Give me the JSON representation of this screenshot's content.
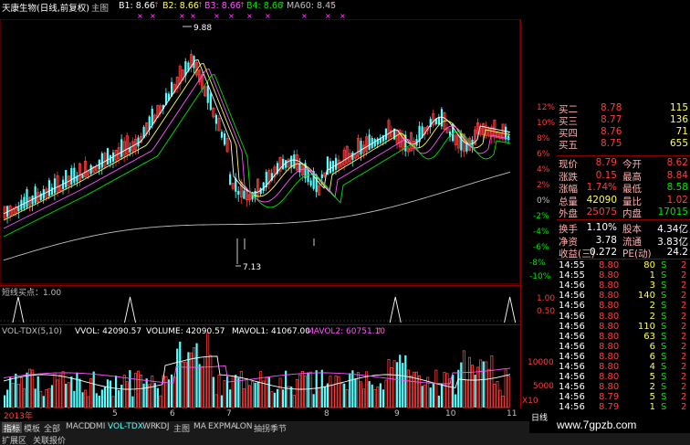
{
  "header": {
    "stock_name": "天康生物(日线,前复权)",
    "tab": "主图",
    "b1": "B1: 8.66",
    "b2": "B2: 8.66",
    "b3": "B3: 8.66",
    "b4": "B4: 8.66",
    "ma60": "MA60: 8.45"
  },
  "colors": {
    "up": "#ff3c3c",
    "down": "#54ffff",
    "border": "#8b0000",
    "ma_white": "#ffffff",
    "ma_yellow": "#ffff54",
    "ma_magenta": "#ff54ff",
    "ma_green": "#00e600"
  },
  "main_chart": {
    "high_label": "9.88",
    "low_label": "7.13",
    "right_axis": [
      "12%",
      "10%",
      "8%",
      "6%",
      "4%",
      "2%",
      "0%",
      "-2%",
      "-4%",
      "-6%",
      "-8%",
      "-10%",
      "-12%"
    ]
  },
  "sub_chart": {
    "title": "短线买点：1.00",
    "axis": [
      "1.00",
      "0.50",
      "0.00"
    ],
    "signals": [
      0.035,
      0.25,
      0.76,
      0.98
    ]
  },
  "volume_chart": {
    "indicator": "VOL-TDX(5,10)",
    "vvol": "VVOL: 42090.57",
    "volume": "VOLUME: 42090.57",
    "mavol1": "MAVOL1: 41067.00",
    "mavol2": "MAVOL2: 60751.10",
    "axis": [
      "10000",
      "5000",
      "X10"
    ]
  },
  "date_axis": [
    "2013年",
    "5",
    "6",
    "7",
    "8",
    "9",
    "10",
    "11"
  ],
  "quote_panel": {
    "rows": [
      {
        "l1": "买二",
        "v1": "8.78",
        "v2": "115",
        "c1": "red",
        "c2": "yel"
      },
      {
        "l1": "买三",
        "v1": "8.77",
        "v2": "136",
        "c1": "red",
        "c2": "yel"
      },
      {
        "l1": "买四",
        "v1": "8.76",
        "v2": "71",
        "c1": "red",
        "c2": "yel"
      },
      {
        "l1": "买五",
        "v1": "8.75",
        "v2": "655",
        "c1": "red",
        "c2": "yel"
      }
    ],
    "stats": [
      {
        "l1": "现价",
        "v1": "8.79",
        "l2": "今开",
        "v2": "8.62",
        "c1": "red",
        "c2": "red"
      },
      {
        "l1": "涨跌",
        "v1": "0.15",
        "l2": "最高",
        "v2": "8.84",
        "c1": "red",
        "c2": "red"
      },
      {
        "l1": "涨幅",
        "v1": "1.74%",
        "l2": "最低",
        "v2": "8.58",
        "c1": "red",
        "c2": "grn"
      },
      {
        "l1": "总量",
        "v1": "42090",
        "l2": "量比",
        "v2": "1.02",
        "c1": "yel",
        "c2": "red"
      },
      {
        "l1": "外盘",
        "v1": "25075",
        "l2": "内盘",
        "v2": "17015",
        "c1": "red",
        "c2": "grn"
      },
      {
        "l1": "换手",
        "v1": "1.10%",
        "l2": "股本",
        "v2": "4.34亿",
        "c1": "wht",
        "c2": "wht"
      },
      {
        "l1": "净资",
        "v1": "3.78",
        "l2": "流通",
        "v2": "3.83亿",
        "c1": "wht",
        "c2": "wht"
      },
      {
        "l1": "收益(三)",
        "v1": "0.272",
        "l2": "PE(动)",
        "v2": "24.2",
        "c1": "wht",
        "c2": "wht"
      }
    ]
  },
  "trades": [
    {
      "time": "14:55",
      "price": "8.80",
      "vol": "80",
      "side": "S"
    },
    {
      "time": "14:55",
      "price": "8.80",
      "vol": "1",
      "side": "S"
    },
    {
      "time": "14:56",
      "price": "8.80",
      "vol": "3",
      "side": "S"
    },
    {
      "time": "14:56",
      "price": "8.80",
      "vol": "140",
      "side": "S"
    },
    {
      "time": "14:56",
      "price": "8.80",
      "vol": "2",
      "side": "S"
    },
    {
      "time": "14:56",
      "price": "8.80",
      "vol": "2",
      "side": "S"
    },
    {
      "time": "14:56",
      "price": "8.80",
      "vol": "110",
      "side": "S"
    },
    {
      "time": "14:56",
      "price": "8.80",
      "vol": "63",
      "side": "S"
    },
    {
      "time": "14:56",
      "price": "8.80",
      "vol": "6",
      "side": "S"
    },
    {
      "time": "14:56",
      "price": "8.80",
      "vol": "6",
      "side": "S"
    },
    {
      "time": "14:56",
      "price": "8.80",
      "vol": "4",
      "side": "S"
    },
    {
      "time": "14:56",
      "price": "8.80",
      "vol": "5",
      "side": "S"
    },
    {
      "time": "14:56",
      "price": "8.80",
      "vol": "2",
      "side": "S"
    },
    {
      "time": "14:56",
      "price": "8.79",
      "vol": "5",
      "side": "S"
    },
    {
      "time": "14:56",
      "price": "8.79",
      "vol": "1",
      "side": "S"
    }
  ],
  "tabs": [
    "指标",
    "模板",
    "全部",
    "MACD",
    "DMI",
    "VOL-TDX",
    "WR",
    "KDJ",
    "主图",
    "MA",
    "EXPMA",
    "LON",
    "抽拐季节"
  ],
  "bottom_tabs": [
    "扩展区",
    "关联报价"
  ],
  "period_label": "日线",
  "watermark": "www.7gpzb.com"
}
